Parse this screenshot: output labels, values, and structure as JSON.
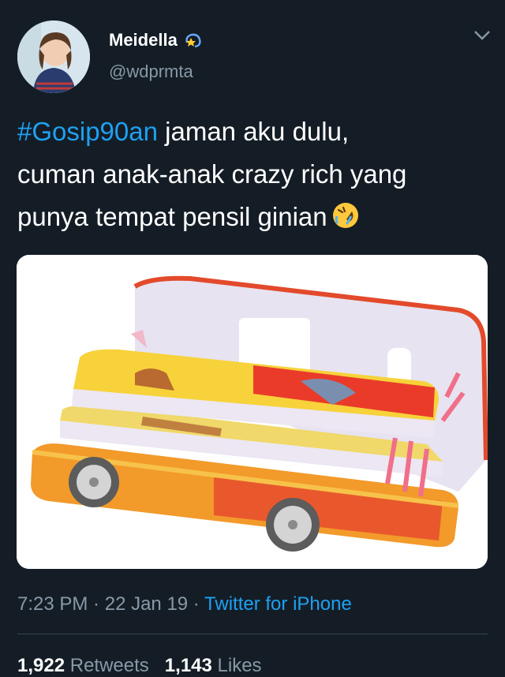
{
  "user": {
    "display_name": "Meidella",
    "handle": "@wdprmta",
    "badge_icon": "dizzy-star-icon",
    "avatar_icon": "profile-photo"
  },
  "tweet": {
    "hashtag": "#Gosip90an",
    "line1_rest": " jaman aku dulu,",
    "line2": "cuman anak-anak crazy rich yang",
    "line3": "punya tempat pensil ginian",
    "emoji_icon": "rolling-on-floor-laughing-emoji"
  },
  "media": {
    "icon": "pencil-case-photo"
  },
  "meta": {
    "time": "7:23 PM",
    "sep1": " · ",
    "date": "22 Jan 19",
    "sep2": " · ",
    "source": "Twitter for iPhone"
  },
  "stats": {
    "retweets_count": "1,922",
    "retweets_label": "Retweets",
    "likes_count": "1,143",
    "likes_label": "Likes"
  },
  "colors": {
    "background": "#141d26",
    "link": "#1da1f2",
    "secondary_text": "#8899a6"
  }
}
